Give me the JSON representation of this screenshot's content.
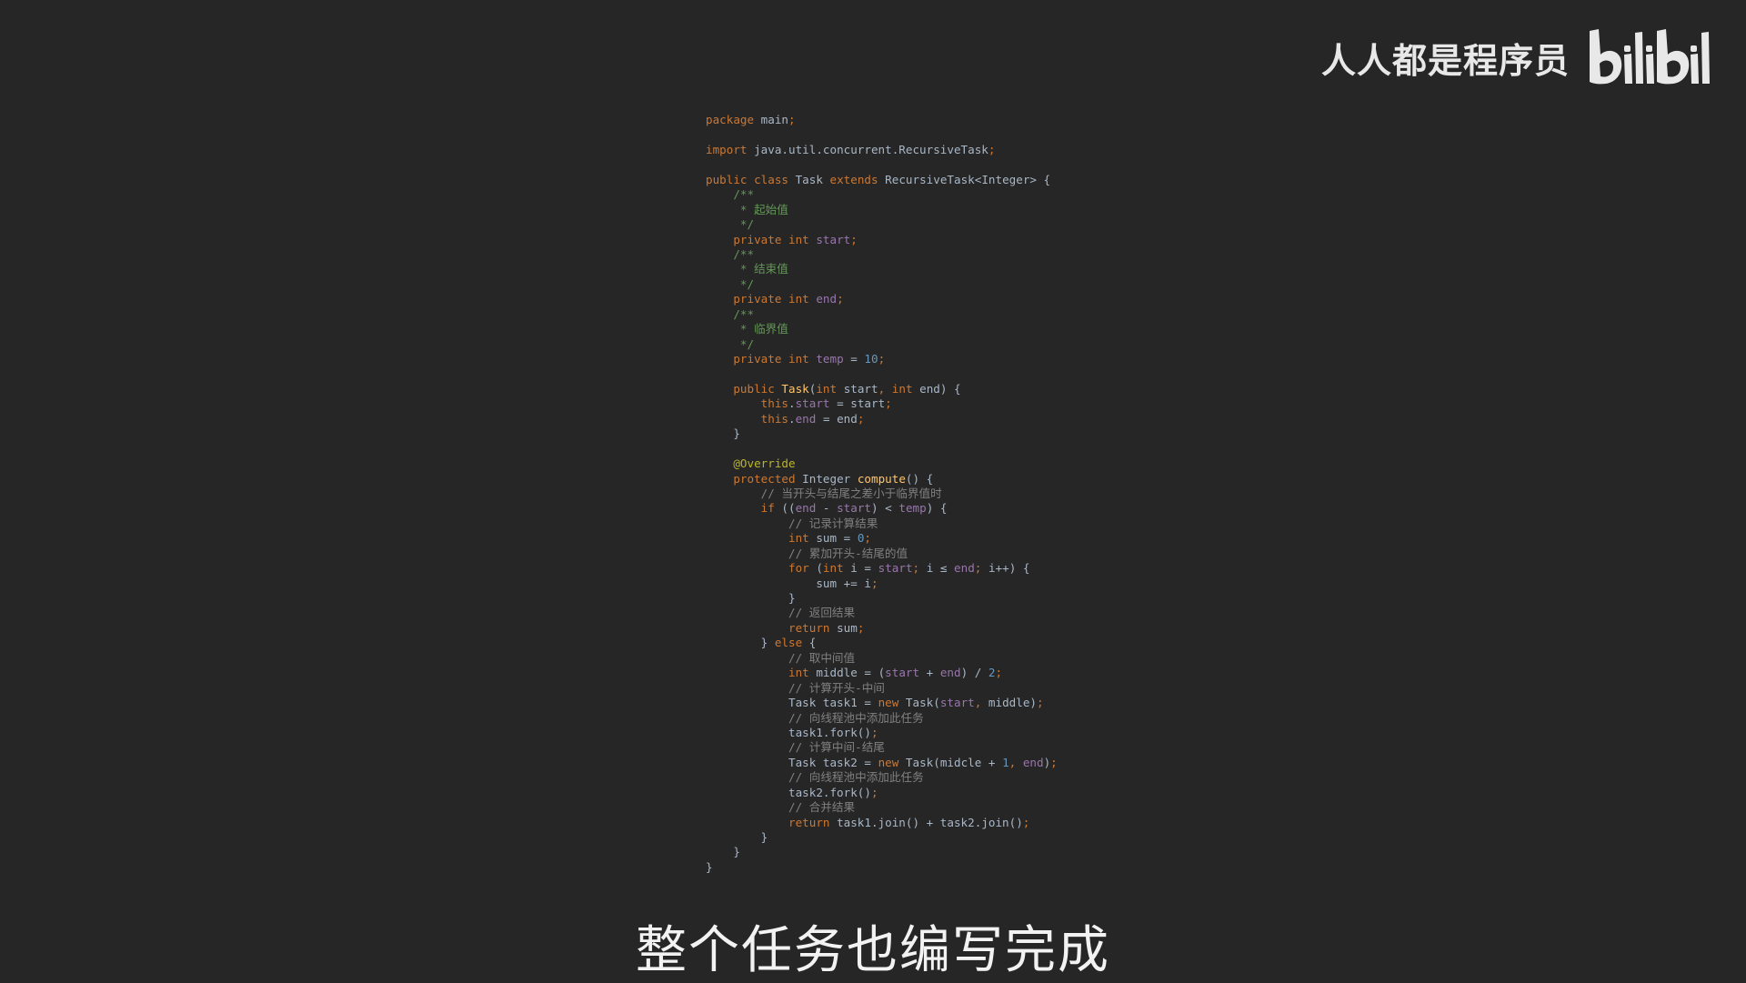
{
  "watermark": {
    "channel_name": "人人都是程序员",
    "logo": "bilibili"
  },
  "code_lines": [
    [
      {
        "t": "package ",
        "c": "kw"
      },
      {
        "t": "main",
        "c": "tx"
      },
      {
        "t": ";",
        "c": "kw"
      }
    ],
    [],
    [
      {
        "t": "import ",
        "c": "kw"
      },
      {
        "t": "java.util.concurrent.RecursiveTask",
        "c": "tx"
      },
      {
        "t": ";",
        "c": "kw"
      }
    ],
    [],
    [
      {
        "t": "public class ",
        "c": "kw"
      },
      {
        "t": "Task ",
        "c": "tx"
      },
      {
        "t": "extends ",
        "c": "kw"
      },
      {
        "t": "RecursiveTask<Integer> {",
        "c": "tx"
      }
    ],
    [
      {
        "t": "    /**",
        "c": "doc"
      }
    ],
    [
      {
        "t": "     * 起始值",
        "c": "doc"
      }
    ],
    [
      {
        "t": "     */",
        "c": "doc"
      }
    ],
    [
      {
        "t": "    private int ",
        "c": "kw"
      },
      {
        "t": "start",
        "c": "fld"
      },
      {
        "t": ";",
        "c": "kw"
      }
    ],
    [
      {
        "t": "    /**",
        "c": "doc"
      }
    ],
    [
      {
        "t": "     * 结束值",
        "c": "doc"
      }
    ],
    [
      {
        "t": "     */",
        "c": "doc"
      }
    ],
    [
      {
        "t": "    private int ",
        "c": "kw"
      },
      {
        "t": "end",
        "c": "fld"
      },
      {
        "t": ";",
        "c": "kw"
      }
    ],
    [
      {
        "t": "    /**",
        "c": "doc"
      }
    ],
    [
      {
        "t": "     * 临界值",
        "c": "doc"
      }
    ],
    [
      {
        "t": "     */",
        "c": "doc"
      }
    ],
    [
      {
        "t": "    private int ",
        "c": "kw"
      },
      {
        "t": "temp ",
        "c": "fld"
      },
      {
        "t": "= ",
        "c": "tx"
      },
      {
        "t": "10",
        "c": "num"
      },
      {
        "t": ";",
        "c": "kw"
      }
    ],
    [],
    [
      {
        "t": "    public ",
        "c": "kw"
      },
      {
        "t": "Task",
        "c": "fn"
      },
      {
        "t": "(",
        "c": "tx"
      },
      {
        "t": "int ",
        "c": "kw"
      },
      {
        "t": "start",
        "c": "tx"
      },
      {
        "t": ", ",
        "c": "kw"
      },
      {
        "t": "int ",
        "c": "kw"
      },
      {
        "t": "end) {",
        "c": "tx"
      }
    ],
    [
      {
        "t": "        this",
        "c": "kw"
      },
      {
        "t": ".",
        "c": "tx"
      },
      {
        "t": "start ",
        "c": "fld"
      },
      {
        "t": "= start",
        "c": "tx"
      },
      {
        "t": ";",
        "c": "kw"
      }
    ],
    [
      {
        "t": "        this",
        "c": "kw"
      },
      {
        "t": ".",
        "c": "tx"
      },
      {
        "t": "end ",
        "c": "fld"
      },
      {
        "t": "= end",
        "c": "tx"
      },
      {
        "t": ";",
        "c": "kw"
      }
    ],
    [
      {
        "t": "    }",
        "c": "tx"
      }
    ],
    [],
    [
      {
        "t": "    @Override",
        "c": "ann"
      }
    ],
    [
      {
        "t": "    protected ",
        "c": "kw"
      },
      {
        "t": "Integer ",
        "c": "tx"
      },
      {
        "t": "compute",
        "c": "fn"
      },
      {
        "t": "() {",
        "c": "tx"
      }
    ],
    [
      {
        "t": "        // 当开头与结尾之差小于临界值时",
        "c": "cm"
      }
    ],
    [
      {
        "t": "        if ",
        "c": "kw"
      },
      {
        "t": "((",
        "c": "tx"
      },
      {
        "t": "end ",
        "c": "fld"
      },
      {
        "t": "- ",
        "c": "tx"
      },
      {
        "t": "start",
        "c": "fld"
      },
      {
        "t": ") < ",
        "c": "tx"
      },
      {
        "t": "temp",
        "c": "fld"
      },
      {
        "t": ") {",
        "c": "tx"
      }
    ],
    [
      {
        "t": "            // 记录计算结果",
        "c": "cm"
      }
    ],
    [
      {
        "t": "            int ",
        "c": "kw"
      },
      {
        "t": "sum = ",
        "c": "tx"
      },
      {
        "t": "0",
        "c": "num"
      },
      {
        "t": ";",
        "c": "kw"
      }
    ],
    [
      {
        "t": "            // 累加开头-结尾的值",
        "c": "cm"
      }
    ],
    [
      {
        "t": "            for ",
        "c": "kw"
      },
      {
        "t": "(",
        "c": "tx"
      },
      {
        "t": "int ",
        "c": "kw"
      },
      {
        "t": "i = ",
        "c": "tx"
      },
      {
        "t": "start",
        "c": "fld"
      },
      {
        "t": "; ",
        "c": "kw"
      },
      {
        "t": "i ≤ ",
        "c": "tx"
      },
      {
        "t": "end",
        "c": "fld"
      },
      {
        "t": "; ",
        "c": "kw"
      },
      {
        "t": "i++) {",
        "c": "tx"
      }
    ],
    [
      {
        "t": "                sum += i",
        "c": "tx"
      },
      {
        "t": ";",
        "c": "kw"
      }
    ],
    [
      {
        "t": "            }",
        "c": "tx"
      }
    ],
    [
      {
        "t": "            // 返回结果",
        "c": "cm"
      }
    ],
    [
      {
        "t": "            return ",
        "c": "kw"
      },
      {
        "t": "sum",
        "c": "tx"
      },
      {
        "t": ";",
        "c": "kw"
      }
    ],
    [
      {
        "t": "        } ",
        "c": "tx"
      },
      {
        "t": "else ",
        "c": "kw"
      },
      {
        "t": "{",
        "c": "tx"
      }
    ],
    [
      {
        "t": "            // 取中间值",
        "c": "cm"
      }
    ],
    [
      {
        "t": "            int ",
        "c": "kw"
      },
      {
        "t": "middle = (",
        "c": "tx"
      },
      {
        "t": "start ",
        "c": "fld"
      },
      {
        "t": "+ ",
        "c": "tx"
      },
      {
        "t": "end",
        "c": "fld"
      },
      {
        "t": ") / ",
        "c": "tx"
      },
      {
        "t": "2",
        "c": "num"
      },
      {
        "t": ";",
        "c": "kw"
      }
    ],
    [
      {
        "t": "            // 计算开头-中间",
        "c": "cm"
      }
    ],
    [
      {
        "t": "            Task task1 = ",
        "c": "tx"
      },
      {
        "t": "new ",
        "c": "kw"
      },
      {
        "t": "Task(",
        "c": "tx"
      },
      {
        "t": "start",
        "c": "fld"
      },
      {
        "t": ", ",
        "c": "kw"
      },
      {
        "t": "middle)",
        "c": "tx"
      },
      {
        "t": ";",
        "c": "kw"
      }
    ],
    [
      {
        "t": "            // 向线程池中添加此任务",
        "c": "cm"
      }
    ],
    [
      {
        "t": "            task1.fork()",
        "c": "tx"
      },
      {
        "t": ";",
        "c": "kw"
      }
    ],
    [
      {
        "t": "            // 计算中间-结尾",
        "c": "cm"
      }
    ],
    [
      {
        "t": "            Task task2 = ",
        "c": "tx"
      },
      {
        "t": "new ",
        "c": "kw"
      },
      {
        "t": "Task(midcle + ",
        "c": "tx"
      },
      {
        "t": "1",
        "c": "num"
      },
      {
        "t": ", ",
        "c": "kw"
      },
      {
        "t": "end",
        "c": "fld"
      },
      {
        "t": ")",
        "c": "tx"
      },
      {
        "t": ";",
        "c": "kw"
      }
    ],
    [
      {
        "t": "            // 向线程池中添加此任务",
        "c": "cm"
      }
    ],
    [
      {
        "t": "            task2.fork()",
        "c": "tx"
      },
      {
        "t": ";",
        "c": "kw"
      }
    ],
    [
      {
        "t": "            // 合并结果",
        "c": "cm"
      }
    ],
    [
      {
        "t": "            return ",
        "c": "kw"
      },
      {
        "t": "task1.join() + task2.join()",
        "c": "tx"
      },
      {
        "t": ";",
        "c": "kw"
      }
    ],
    [
      {
        "t": "        }",
        "c": "tx"
      }
    ],
    [
      {
        "t": "    }",
        "c": "tx"
      }
    ],
    [
      {
        "t": "}",
        "c": "tx"
      }
    ]
  ],
  "subtitle": "整个任务也编写完成"
}
